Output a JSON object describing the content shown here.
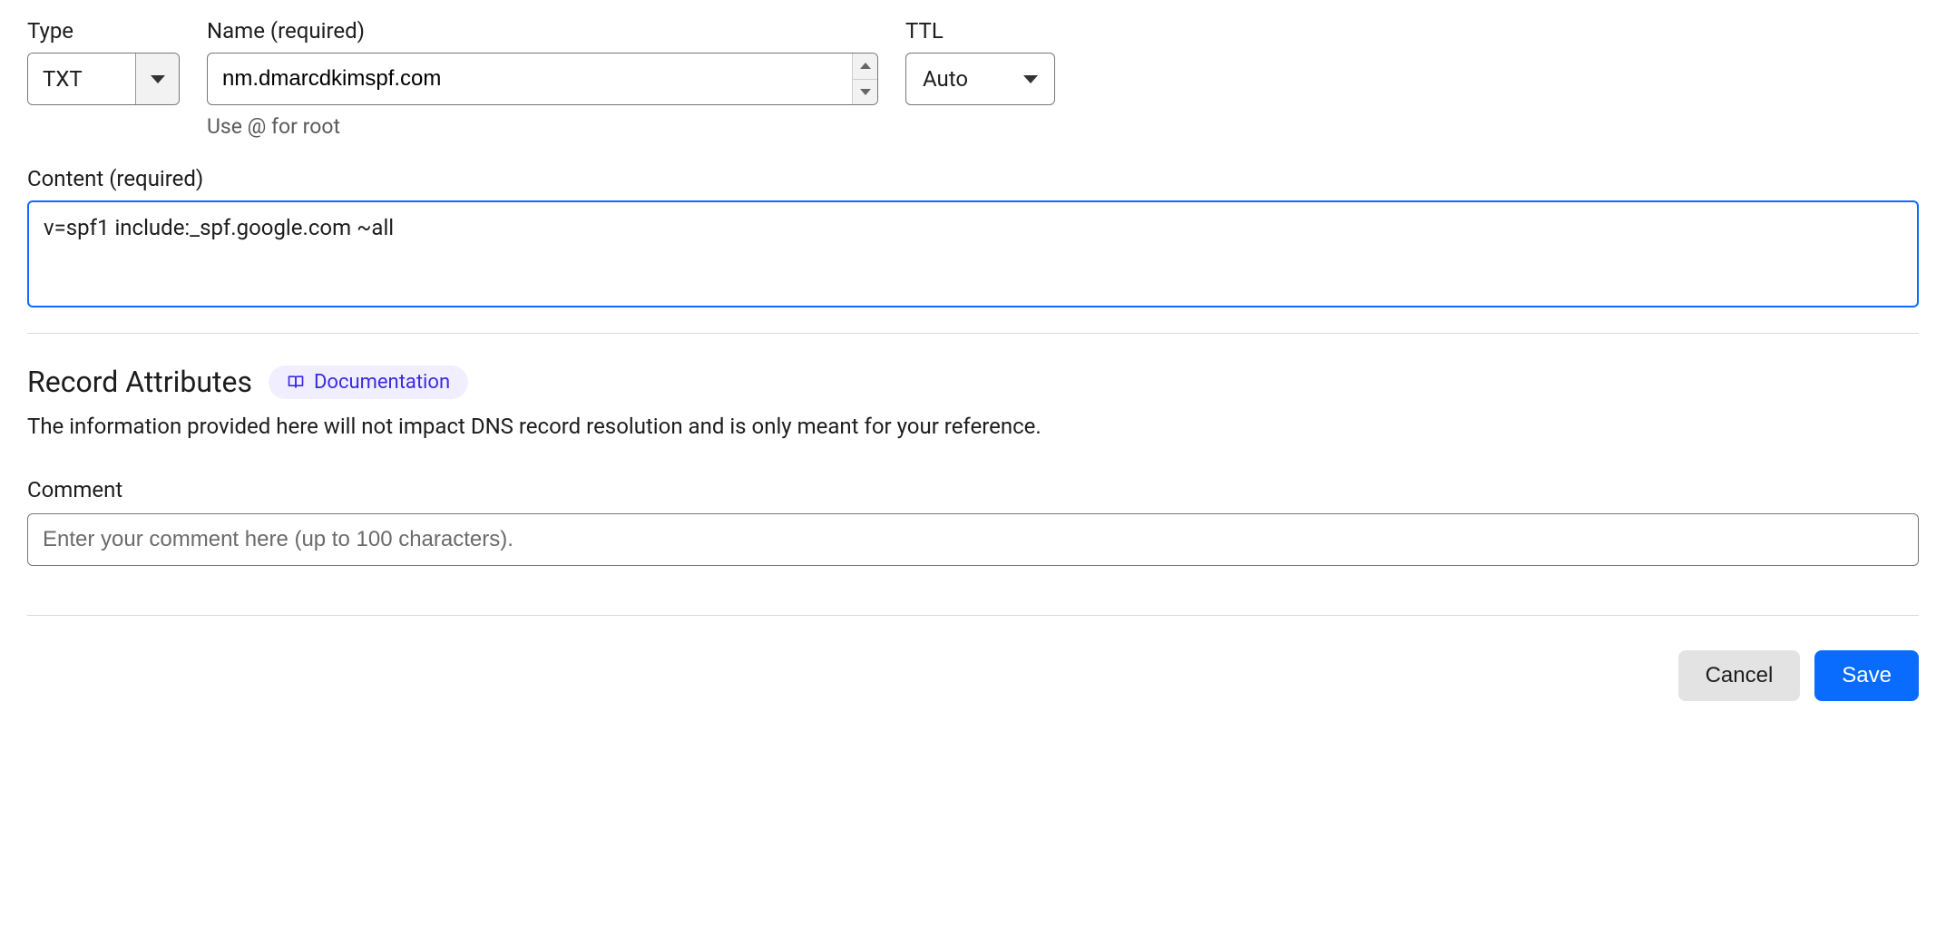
{
  "form": {
    "type": {
      "label": "Type",
      "value": "TXT"
    },
    "name": {
      "label": "Name (required)",
      "value": "nm.dmarcdkimspf.com",
      "hint": "Use @ for root"
    },
    "ttl": {
      "label": "TTL",
      "value": "Auto"
    },
    "content": {
      "label": "Content (required)",
      "value": "v=spf1 include:_spf.google.com ~all"
    }
  },
  "attributes": {
    "title": "Record Attributes",
    "doc_label": "Documentation",
    "description": "The information provided here will not impact DNS record resolution and is only meant for your reference."
  },
  "comment": {
    "label": "Comment",
    "placeholder": "Enter your comment here (up to 100 characters).",
    "value": ""
  },
  "buttons": {
    "cancel": "Cancel",
    "save": "Save"
  }
}
